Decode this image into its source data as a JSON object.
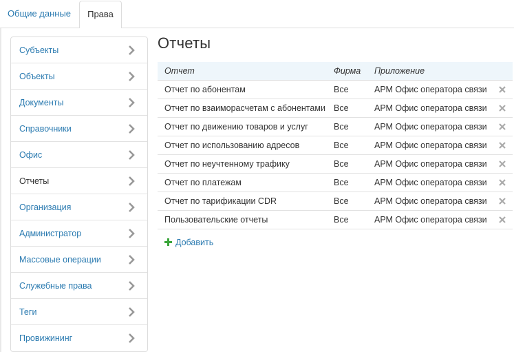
{
  "tabs": {
    "general": "Общие данные",
    "rights": "Права"
  },
  "sidebar": {
    "items": [
      {
        "label": "Субъекты"
      },
      {
        "label": "Объекты"
      },
      {
        "label": "Документы"
      },
      {
        "label": "Справочники"
      },
      {
        "label": "Офис"
      },
      {
        "label": "Отчеты",
        "active": true
      },
      {
        "label": "Организация"
      },
      {
        "label": "Администратор"
      },
      {
        "label": "Массовые операции"
      },
      {
        "label": "Служебные права"
      },
      {
        "label": "Теги"
      },
      {
        "label": "Провижининг"
      }
    ]
  },
  "main": {
    "title": "Отчеты",
    "columns": {
      "report": "Отчет",
      "firm": "Фирма",
      "app": "Приложение"
    },
    "rows": [
      {
        "report": "Отчет по абонентам",
        "firm": "Все",
        "app": "АРМ Офис оператора связи"
      },
      {
        "report": "Отчет по взаиморасчетам с абонентами",
        "firm": "Все",
        "app": "АРМ Офис оператора связи"
      },
      {
        "report": "Отчет по движению товаров и услуг",
        "firm": "Все",
        "app": "АРМ Офис оператора связи"
      },
      {
        "report": "Отчет по использованию адресов",
        "firm": "Все",
        "app": "АРМ Офис оператора связи"
      },
      {
        "report": "Отчет по неучтенному трафику",
        "firm": "Все",
        "app": "АРМ Офис оператора связи"
      },
      {
        "report": "Отчет по платежам",
        "firm": "Все",
        "app": "АРМ Офис оператора связи"
      },
      {
        "report": "Отчет по тарификации CDR",
        "firm": "Все",
        "app": "АРМ Офис оператора связи"
      },
      {
        "report": "Пользовательские отчеты",
        "firm": "Все",
        "app": "АРМ Офис оператора связи"
      }
    ],
    "add_label": "Добавить"
  },
  "colors": {
    "link": "#2a7ab0",
    "add_icon": "#3aa53a",
    "header_bg": "#eef6fb"
  },
  "icons": {
    "sidebar_item": "chevron-right-icon",
    "row_delete": "close-icon",
    "add": "plus-icon"
  }
}
